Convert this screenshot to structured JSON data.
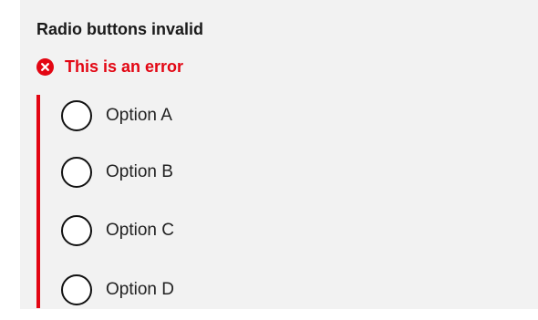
{
  "fieldset": {
    "legend": "Radio buttons invalid",
    "error_message": "This is an error",
    "options": [
      {
        "label": "Option A",
        "checked": false
      },
      {
        "label": "Option B",
        "checked": false
      },
      {
        "label": "Option C",
        "checked": false
      },
      {
        "label": "Option D",
        "checked": false
      }
    ]
  },
  "colors": {
    "error": "#e30613",
    "panel_background": "#f2f2f2",
    "text": "#1a1a1a"
  },
  "icons": {
    "error": "error-circle-x-icon"
  }
}
